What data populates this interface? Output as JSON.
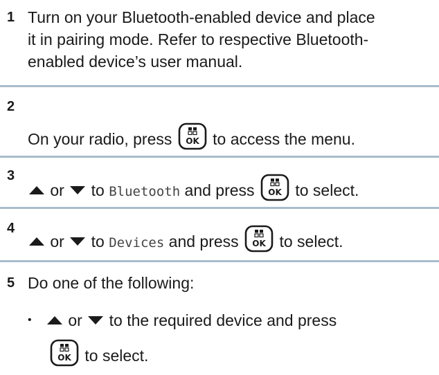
{
  "steps": [
    {
      "number": "1",
      "lines": [
        "Turn on your Bluetooth-enabled device and place",
        "it in pairing mode. Refer to respective Bluetooth-",
        "enabled device’s user manual."
      ]
    },
    {
      "number": "2",
      "before": "On your radio, press",
      "after": "to access the menu."
    },
    {
      "number": "3",
      "or": "or",
      "to": "to",
      "menu_item": "Bluetooth",
      "and_press": "and press",
      "after": "to select."
    },
    {
      "number": "4",
      "or": "or",
      "to": "to",
      "menu_item": "Devices",
      "and_press": "and press",
      "after": "to select."
    },
    {
      "number": "5",
      "intro": "Do one of the following:",
      "bullet": "•",
      "or": "or",
      "bullet_text": "to the required device and press",
      "after": "to select."
    }
  ],
  "ok_key": {
    "label": "OK",
    "icon": "menu-ok-key-icon"
  },
  "colors": {
    "separator": "#a8bccb",
    "text": "#1a1a1a"
  }
}
